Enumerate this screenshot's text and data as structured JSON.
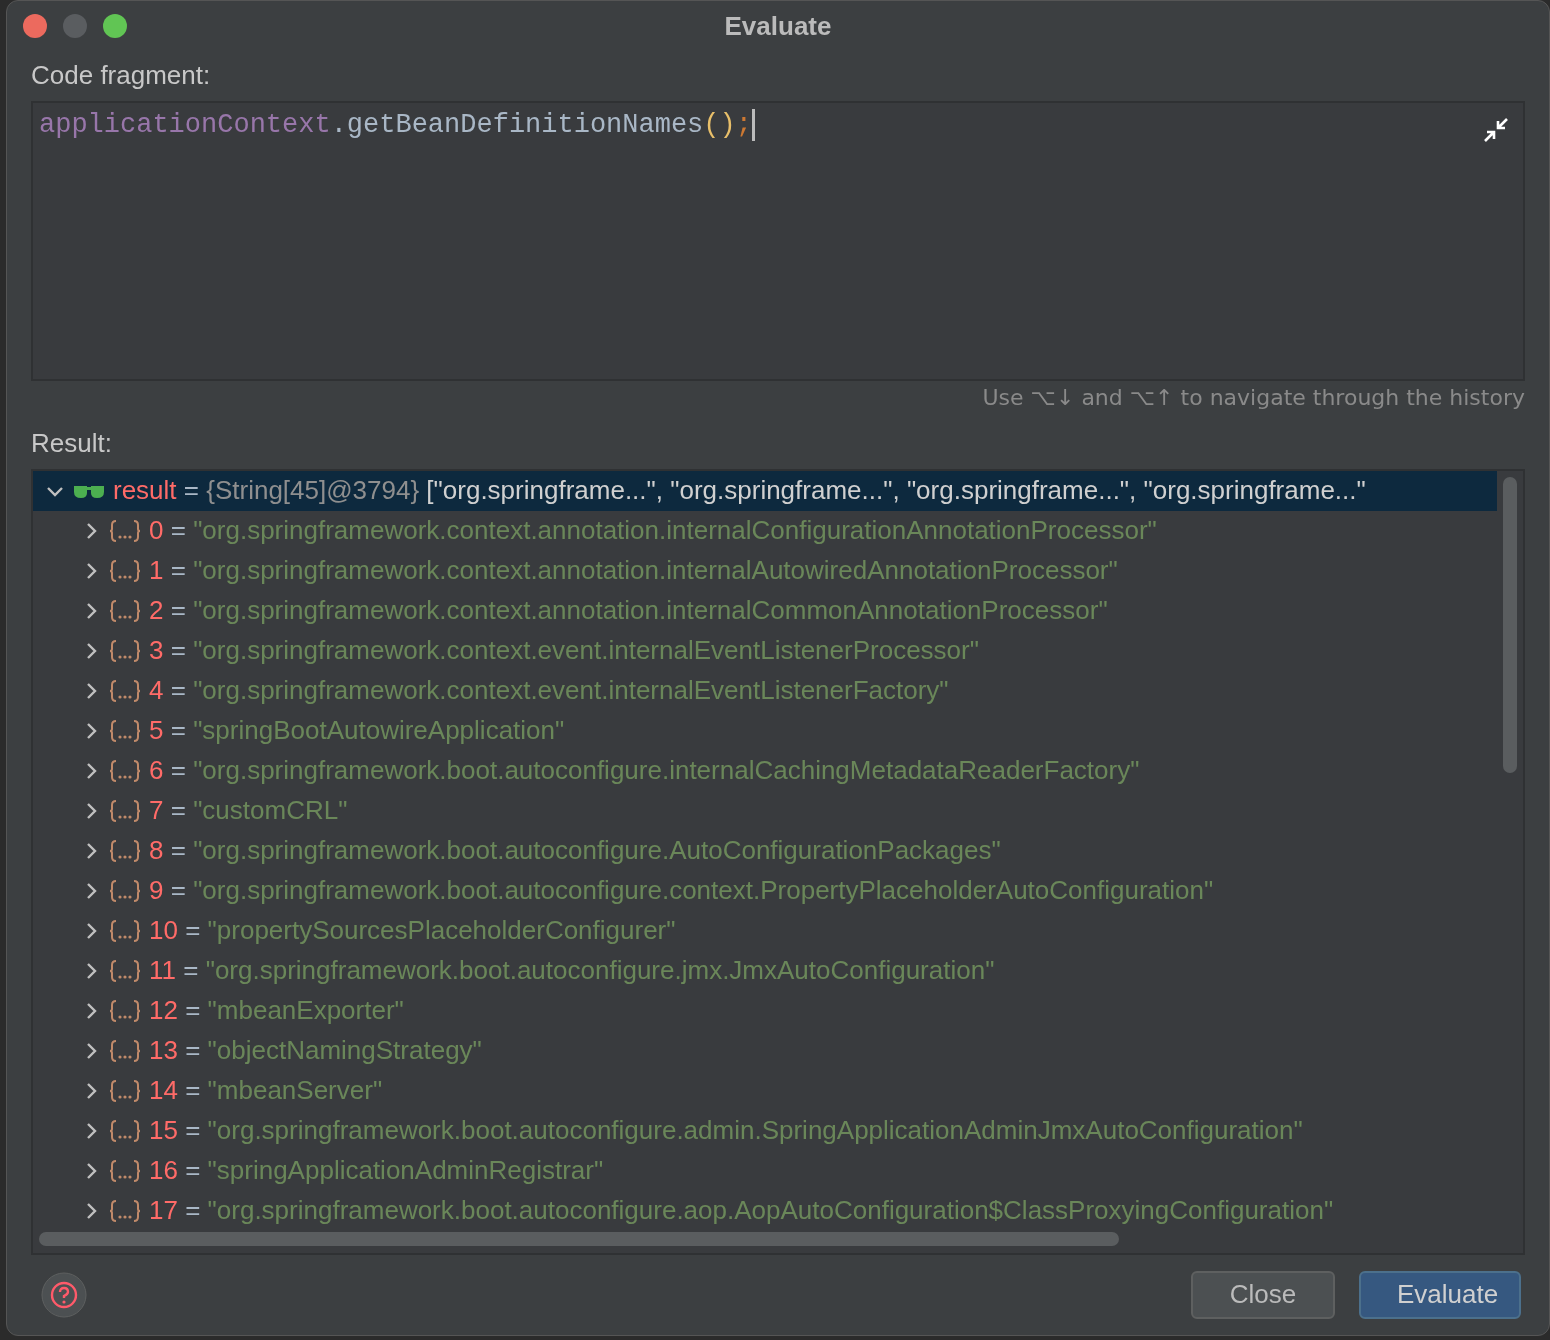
{
  "window": {
    "title": "Evaluate"
  },
  "code_fragment": {
    "label": "Code fragment:",
    "tokens": [
      {
        "text": "applicationContext",
        "kind": "field"
      },
      {
        "text": ".getBeanDefinitionNames",
        "kind": "plain"
      },
      {
        "text": "()",
        "kind": "paren"
      },
      {
        "text": ";",
        "kind": "semicolon"
      }
    ]
  },
  "history_hint": "Use ⌥↓ and ⌥↑ to navigate through the history",
  "result": {
    "label": "Result:",
    "tree": [
      {
        "name": "result",
        "separator": "=",
        "type": "{String[45]@3794}",
        "value": "[\"org.springframe...\", \"org.springframe...\", \"org.springframe...\", \"org.springframe...\"",
        "expanded": true,
        "selected": true,
        "children": [
          {
            "name": "0",
            "separator": "=",
            "value": "\"org.springframework.context.annotation.internalConfigurationAnnotationProcessor\"",
            "expanded": false,
            "selected": false
          },
          {
            "name": "1",
            "separator": "=",
            "value": "\"org.springframework.context.annotation.internalAutowiredAnnotationProcessor\"",
            "expanded": false,
            "selected": false
          },
          {
            "name": "2",
            "separator": "=",
            "value": "\"org.springframework.context.annotation.internalCommonAnnotationProcessor\"",
            "expanded": false,
            "selected": false
          },
          {
            "name": "3",
            "separator": "=",
            "value": "\"org.springframework.context.event.internalEventListenerProcessor\"",
            "expanded": false,
            "selected": false
          },
          {
            "name": "4",
            "separator": "=",
            "value": "\"org.springframework.context.event.internalEventListenerFactory\"",
            "expanded": false,
            "selected": false
          },
          {
            "name": "5",
            "separator": "=",
            "value": "\"springBootAutowireApplication\"",
            "expanded": false,
            "selected": false
          },
          {
            "name": "6",
            "separator": "=",
            "value": "\"org.springframework.boot.autoconfigure.internalCachingMetadataReaderFactory\"",
            "expanded": false,
            "selected": false
          },
          {
            "name": "7",
            "separator": "=",
            "value": "\"customCRL\"",
            "expanded": false,
            "selected": false
          },
          {
            "name": "8",
            "separator": "=",
            "value": "\"org.springframework.boot.autoconfigure.AutoConfigurationPackages\"",
            "expanded": false,
            "selected": false
          },
          {
            "name": "9",
            "separator": "=",
            "value": "\"org.springframework.boot.autoconfigure.context.PropertyPlaceholderAutoConfiguration\"",
            "expanded": false,
            "selected": false
          },
          {
            "name": "10",
            "separator": "=",
            "value": "\"propertySourcesPlaceholderConfigurer\"",
            "expanded": false,
            "selected": false
          },
          {
            "name": "11",
            "separator": "=",
            "value": "\"org.springframework.boot.autoconfigure.jmx.JmxAutoConfiguration\"",
            "expanded": false,
            "selected": false
          },
          {
            "name": "12",
            "separator": "=",
            "value": "\"mbeanExporter\"",
            "expanded": false,
            "selected": false
          },
          {
            "name": "13",
            "separator": "=",
            "value": "\"objectNamingStrategy\"",
            "expanded": false,
            "selected": false
          },
          {
            "name": "14",
            "separator": "=",
            "value": "\"mbeanServer\"",
            "expanded": false,
            "selected": false
          },
          {
            "name": "15",
            "separator": "=",
            "value": "\"org.springframework.boot.autoconfigure.admin.SpringApplicationAdminJmxAutoConfiguration\"",
            "expanded": false,
            "selected": false
          },
          {
            "name": "16",
            "separator": "=",
            "value": "\"springApplicationAdminRegistrar\"",
            "expanded": false,
            "selected": false
          },
          {
            "name": "17",
            "separator": "=",
            "value": "\"org.springframework.boot.autoconfigure.aop.AopAutoConfiguration$ClassProxyingConfiguration\"",
            "expanded": false,
            "selected": false
          }
        ]
      }
    ]
  },
  "buttons": [
    {
      "label": "Close",
      "kind": "secondary"
    },
    {
      "label": "Evaluate",
      "kind": "default"
    }
  ]
}
